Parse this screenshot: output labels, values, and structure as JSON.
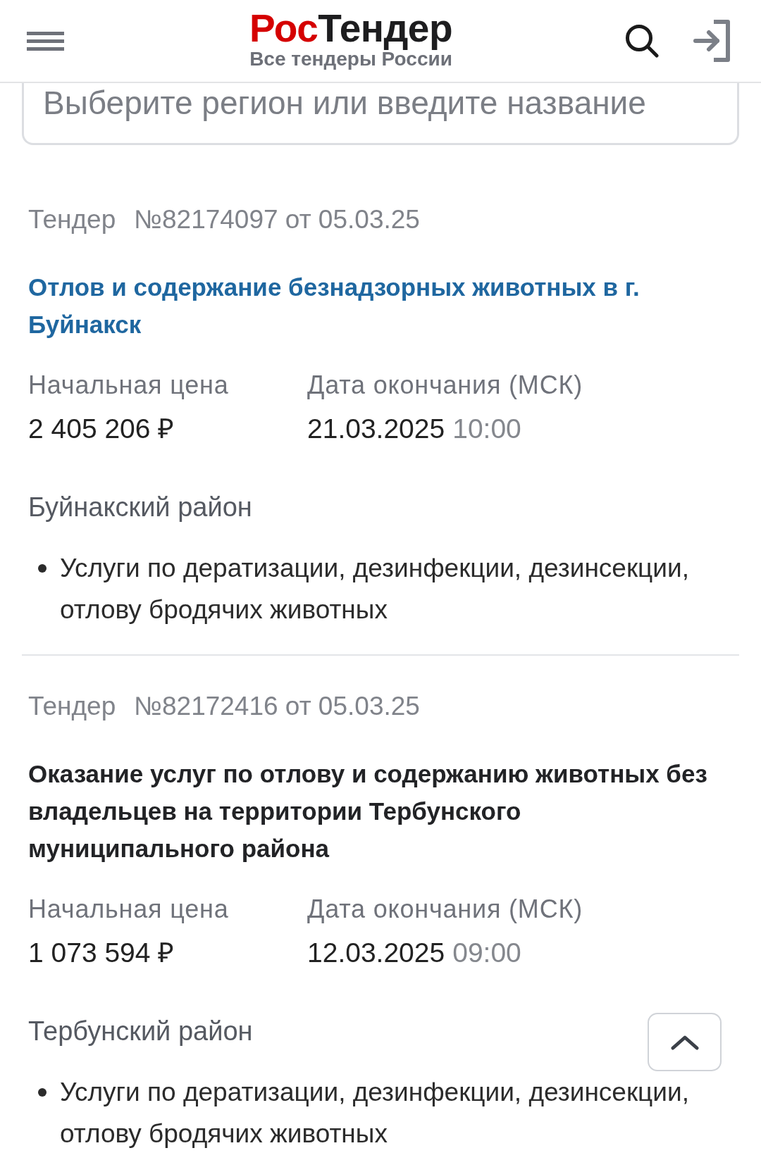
{
  "header": {
    "logo": {
      "accent": "Рос",
      "text": "Тендер"
    },
    "tagline": "Все тендеры России"
  },
  "search": {
    "placeholder": "Выберите регион или введите название"
  },
  "tenders": [
    {
      "type_label": "Тендер",
      "number": "№82174097 от 05.03.25",
      "title": "Отлов и содержание безнадзорных животных в г. Буйнакск",
      "highlighted": true,
      "price_label": "Начальная цена",
      "price": "2 405 206 ₽",
      "deadline_label": "Дата окончания (МСК)",
      "deadline_date": "21.03.2025",
      "deadline_time": "10:00",
      "region": "Буйнакский район",
      "categories": [
        "Услуги по дератизации, дезинфекции, дезинсекции, отлову бродячих животных"
      ]
    },
    {
      "type_label": "Тендер",
      "number": "№82172416 от 05.03.25",
      "title": "Оказание услуг по отлову и содержанию животных без владельцев на территории Тербунского муниципального района",
      "highlighted": false,
      "price_label": "Начальная цена",
      "price": "1 073 594 ₽",
      "deadline_label": "Дата окончания (МСК)",
      "deadline_date": "12.03.2025",
      "deadline_time": "09:00",
      "region": "Тербунский район",
      "categories": [
        "Услуги по дератизации, дезинфекции, дезинсекции, отлову бродячих животных"
      ]
    }
  ]
}
